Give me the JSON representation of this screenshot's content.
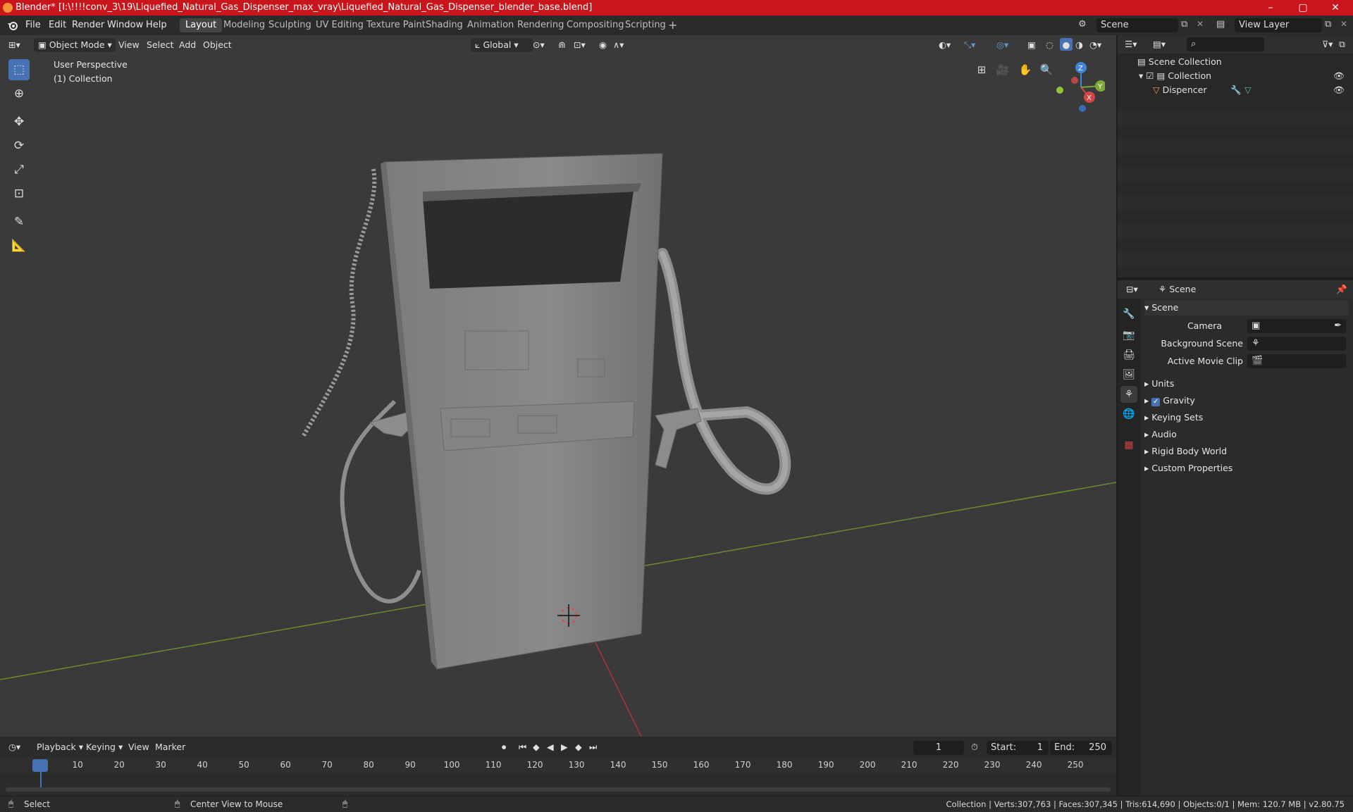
{
  "window": {
    "title": "Blender* [I:\\!!!!conv_3\\19\\Liquefied_Natural_Gas_Dispenser_max_vray\\Liquefied_Natural_Gas_Dispenser_blender_base.blend]",
    "controls": [
      "–",
      "▢",
      "✕"
    ]
  },
  "menu": {
    "items": [
      "File",
      "Edit",
      "Render",
      "Window",
      "Help"
    ],
    "workspaces": [
      "Layout",
      "Modeling",
      "Sculpting",
      "UV Editing",
      "Texture Paint",
      "Shading",
      "Animation",
      "Rendering",
      "Compositing",
      "Scripting"
    ],
    "active_workspace": "Layout",
    "add_tab": "+",
    "scene_name": "Scene",
    "view_layer": "View Layer"
  },
  "viewport_header": {
    "mode": "Object Mode",
    "menus": [
      "View",
      "Select",
      "Add",
      "Object"
    ],
    "orientation": "Global"
  },
  "viewport": {
    "perspective_label": "User Perspective",
    "collection_label": "(1) Collection",
    "gizmo_axes": {
      "z": "Z",
      "y": "Y",
      "x": "X"
    }
  },
  "outliner": {
    "root": "Scene Collection",
    "items": [
      {
        "label": "Collection"
      },
      {
        "label": "Dispencer"
      }
    ]
  },
  "properties": {
    "header": "Scene",
    "section": "Scene",
    "fields": [
      {
        "label": "Camera",
        "value": ""
      },
      {
        "label": "Background Scene",
        "value": ""
      },
      {
        "label": "Active Movie Clip",
        "value": ""
      }
    ],
    "panels": [
      "Units",
      "Gravity",
      "Keying Sets",
      "Audio",
      "Rigid Body World",
      "Custom Properties"
    ],
    "gravity_checked": true
  },
  "timeline": {
    "menus": [
      "Playback",
      "Keying",
      "View",
      "Marker"
    ],
    "current_frame": "1",
    "start_label": "Start:",
    "start": "1",
    "end_label": "End:",
    "end": "250",
    "ticks": [
      "1",
      "10",
      "20",
      "30",
      "40",
      "50",
      "60",
      "70",
      "80",
      "90",
      "100",
      "110",
      "120",
      "130",
      "140",
      "150",
      "160",
      "170",
      "180",
      "190",
      "200",
      "210",
      "220",
      "230",
      "240",
      "250"
    ]
  },
  "statusbar": {
    "select": "Select",
    "center": "Center View to Mouse",
    "stats": "Collection | Verts:307,763 | Faces:307,345 | Tris:614,690 | Objects:0/1 | Mem: 120.7 MB | v2.80.75"
  },
  "colors": {
    "titlebar": "#c9151c",
    "accent": "#4772b3",
    "viewport_bg": "#3a3a3a",
    "x_axis": "#d64545",
    "y_axis": "#7fa83a",
    "z_axis": "#3f86d9"
  }
}
